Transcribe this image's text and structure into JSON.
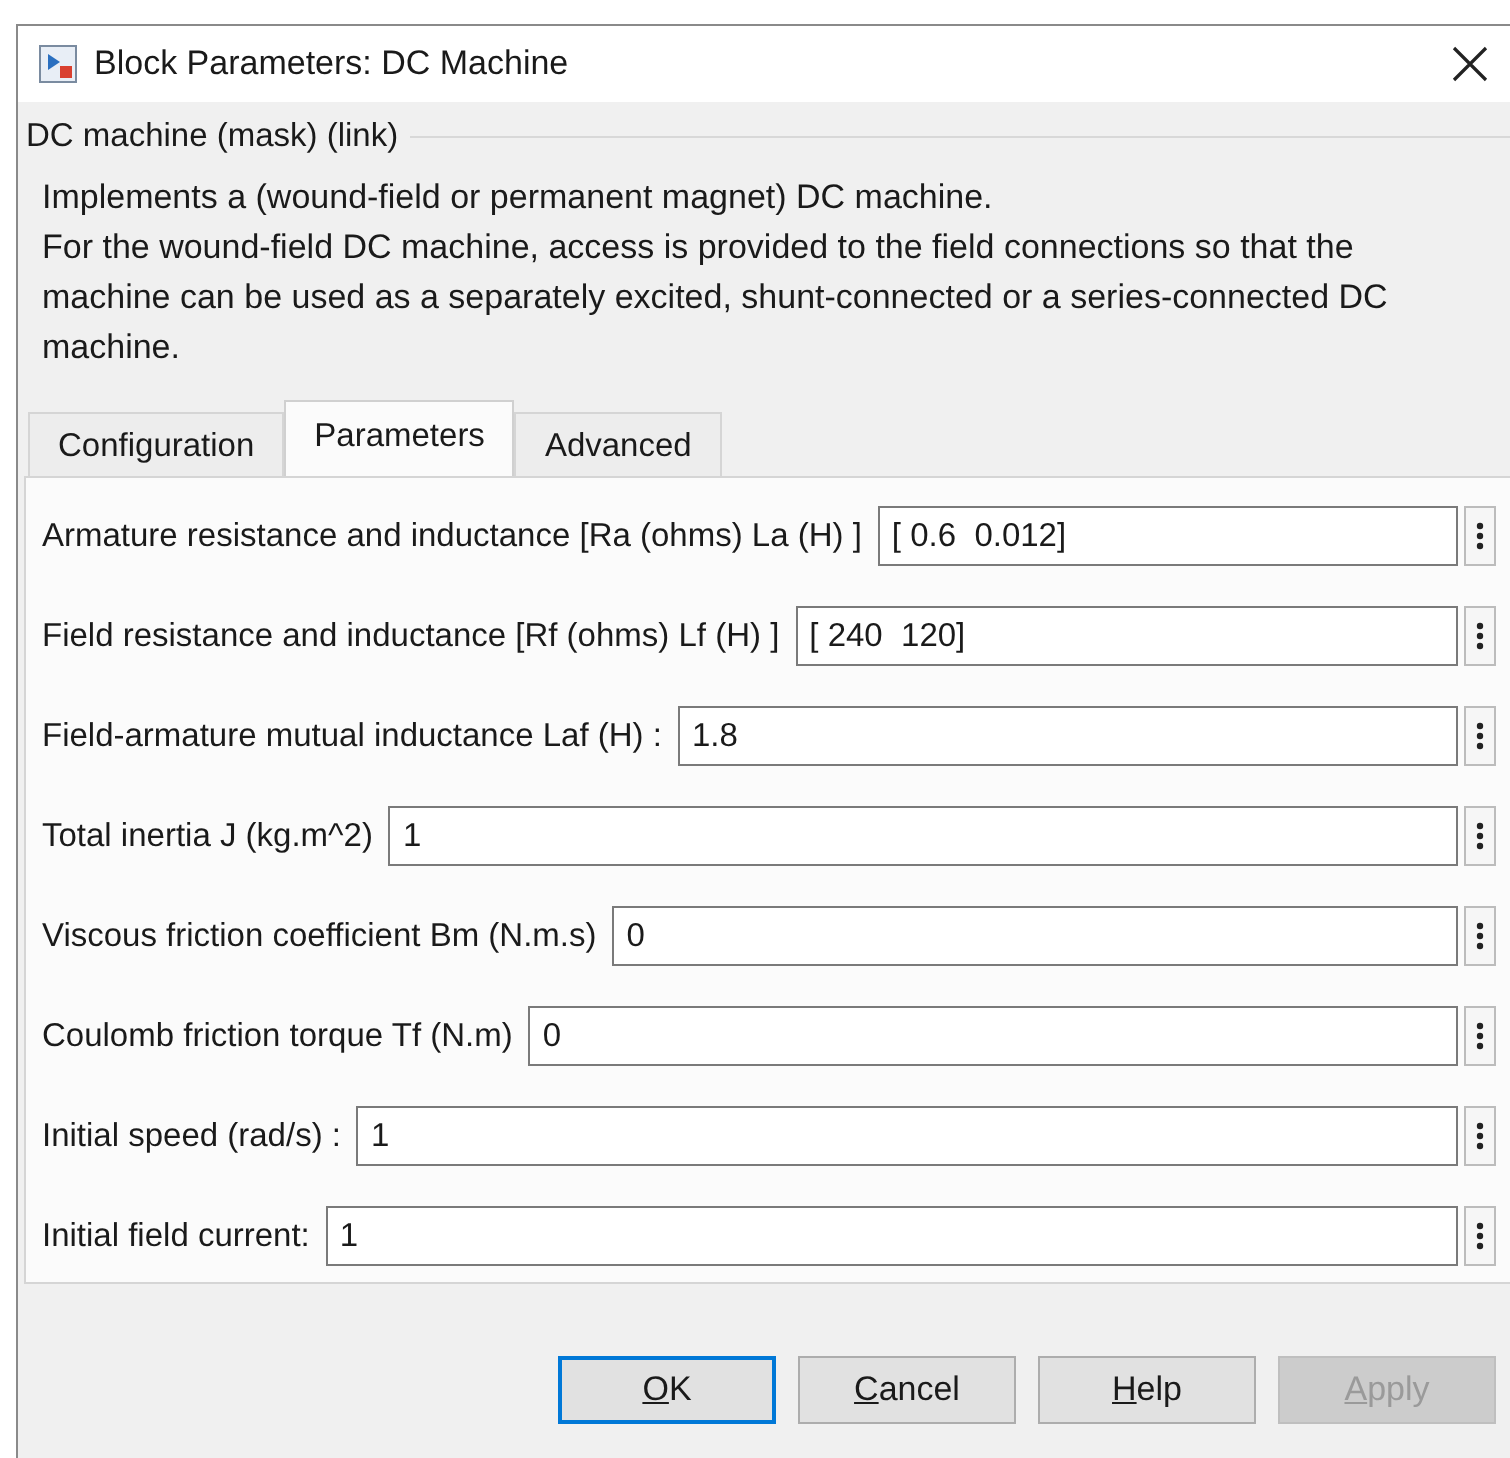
{
  "window": {
    "title": "Block Parameters: DC Machine"
  },
  "group": {
    "title": "DC machine (mask) (link)",
    "description": [
      "Implements a (wound-field or permanent magnet) DC machine.",
      "For the wound-field DC machine, access is provided to the field connections so that the machine can be used as a separately excited, shunt-connected or a series-connected  DC machine."
    ]
  },
  "tabs": [
    {
      "label": "Configuration",
      "selected": false
    },
    {
      "label": "Parameters",
      "selected": true
    },
    {
      "label": "Advanced",
      "selected": false
    }
  ],
  "parameters": [
    {
      "label": "Armature resistance and inductance [Ra (ohms) La (H) ]",
      "value": "[ 0.6  0.012]"
    },
    {
      "label": "Field resistance and inductance [Rf (ohms) Lf (H) ]",
      "value": "[ 240  120]"
    },
    {
      "label": "Field-armature mutual inductance Laf (H) :",
      "value": "1.8"
    },
    {
      "label": "Total inertia J (kg.m^2)",
      "value": "1"
    },
    {
      "label": "Viscous friction coefficient Bm (N.m.s)",
      "value": "0"
    },
    {
      "label": "Coulomb friction torque Tf (N.m)",
      "value": "0"
    },
    {
      "label": "Initial speed (rad/s) :",
      "value": "1"
    },
    {
      "label": "Initial field current:",
      "value": "1"
    }
  ],
  "buttons": [
    {
      "label": "OK",
      "default": true,
      "disabled": false
    },
    {
      "label": "Cancel",
      "default": false,
      "disabled": false
    },
    {
      "label": "Help",
      "default": false,
      "disabled": false
    },
    {
      "label": "Apply",
      "default": false,
      "disabled": true
    }
  ]
}
